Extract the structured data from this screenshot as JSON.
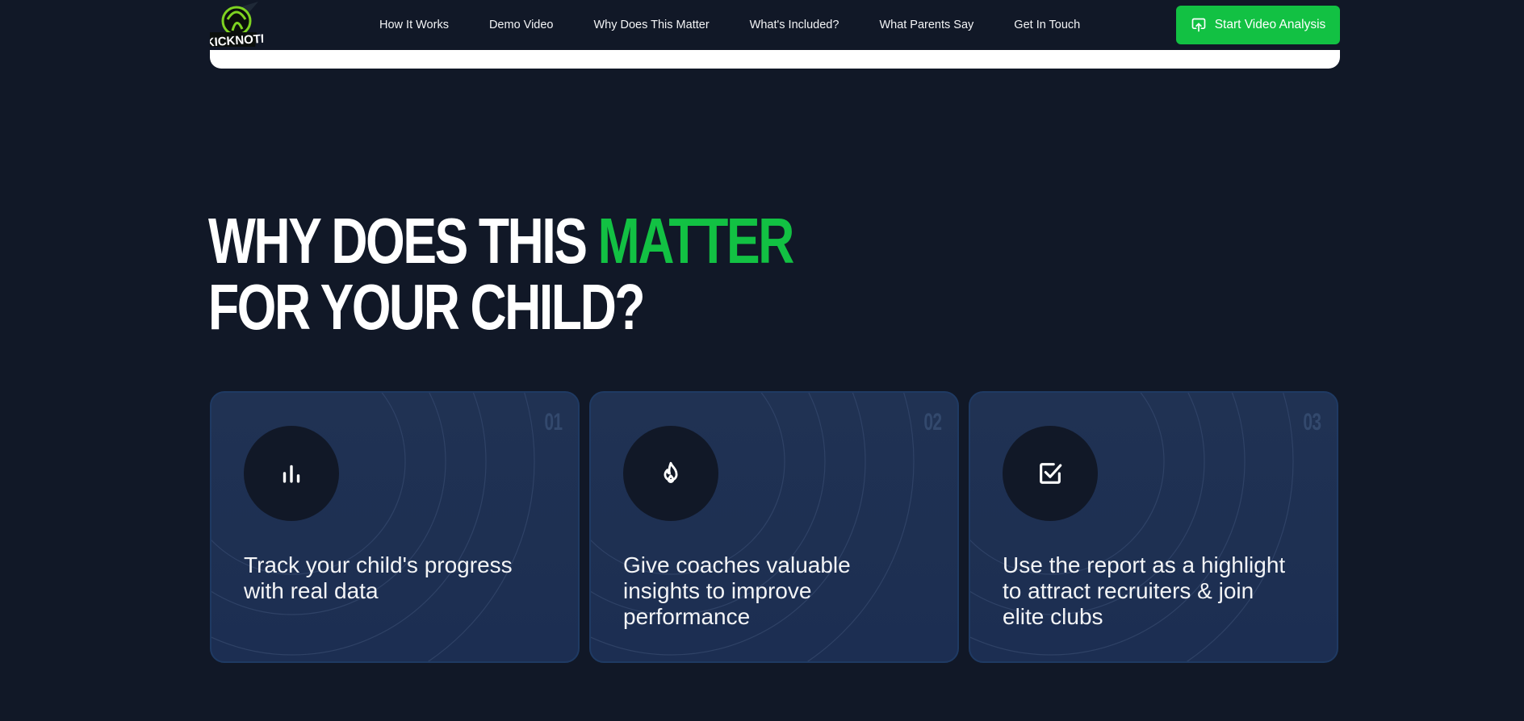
{
  "brand": {
    "name": "KICKNOTE"
  },
  "nav": {
    "links": [
      "How It Works",
      "Demo Video",
      "Why Does This Matter",
      "What's Included?",
      "What Parents Say",
      "Get In Touch"
    ],
    "cta": "Start Video Analysis"
  },
  "section": {
    "headline_part1": "WHY DOES THIS ",
    "headline_accent": "MATTER",
    "headline_part2": "FOR YOUR CHILD?"
  },
  "cards": [
    {
      "number": "01",
      "icon": "bar-chart-icon",
      "text": "Track your child's progress with real data"
    },
    {
      "number": "02",
      "icon": "flame-icon",
      "text": "Give coaches valuable insights to improve performance"
    },
    {
      "number": "03",
      "icon": "checkbox-icon",
      "text": "Use the report as a highlight to attract recruiters & join elite clubs"
    }
  ],
  "colors": {
    "background": "#111827",
    "accent": "#12c143",
    "card": "#1e3053"
  }
}
